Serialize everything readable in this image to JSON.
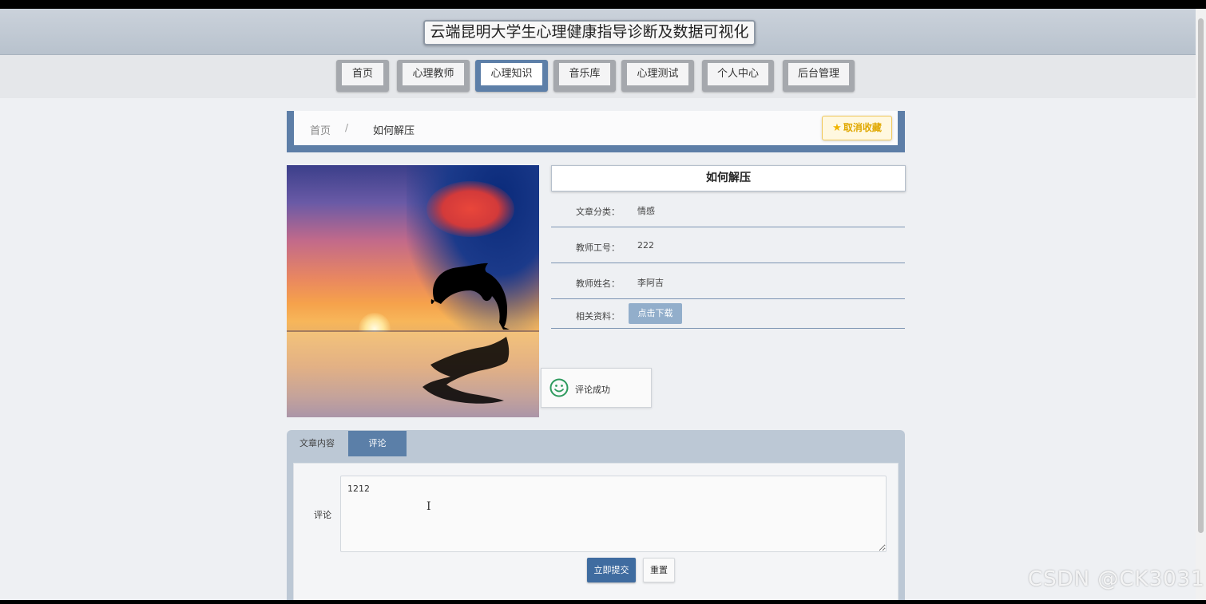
{
  "site": {
    "title": "云端昆明大学生心理健康指导诊断及数据可视化"
  },
  "nav": {
    "items": [
      {
        "label": "首页"
      },
      {
        "label": "心理教师"
      },
      {
        "label": "心理知识"
      },
      {
        "label": "音乐库"
      },
      {
        "label": "心理测试"
      },
      {
        "label": "个人中心"
      },
      {
        "label": "后台管理"
      }
    ],
    "active": "心理知识"
  },
  "breadcrumb": {
    "home": "首页",
    "separator": "/",
    "current": "如何解压"
  },
  "favorite": {
    "label": "取消收藏"
  },
  "article": {
    "title": "如何解压",
    "fields": [
      {
        "label": "文章分类：",
        "value": "情感"
      },
      {
        "label": "教师工号：",
        "value": "222"
      },
      {
        "label": "教师姓名：",
        "value": "李阿吉"
      },
      {
        "label": "相关资料：",
        "button": "点击下载"
      }
    ]
  },
  "toast": {
    "message": "评论成功"
  },
  "tabs": {
    "content": "文章内容",
    "comment": "评论",
    "active": "评论"
  },
  "comment_form": {
    "label": "评论",
    "value": "1212",
    "submit": "立即提交",
    "reset": "重置"
  },
  "watermark": "CSDN @CK3031",
  "colors": {
    "accent": "#5d7fa8",
    "primary_button": "#3f6ca0",
    "favorite": "#e0a800"
  }
}
